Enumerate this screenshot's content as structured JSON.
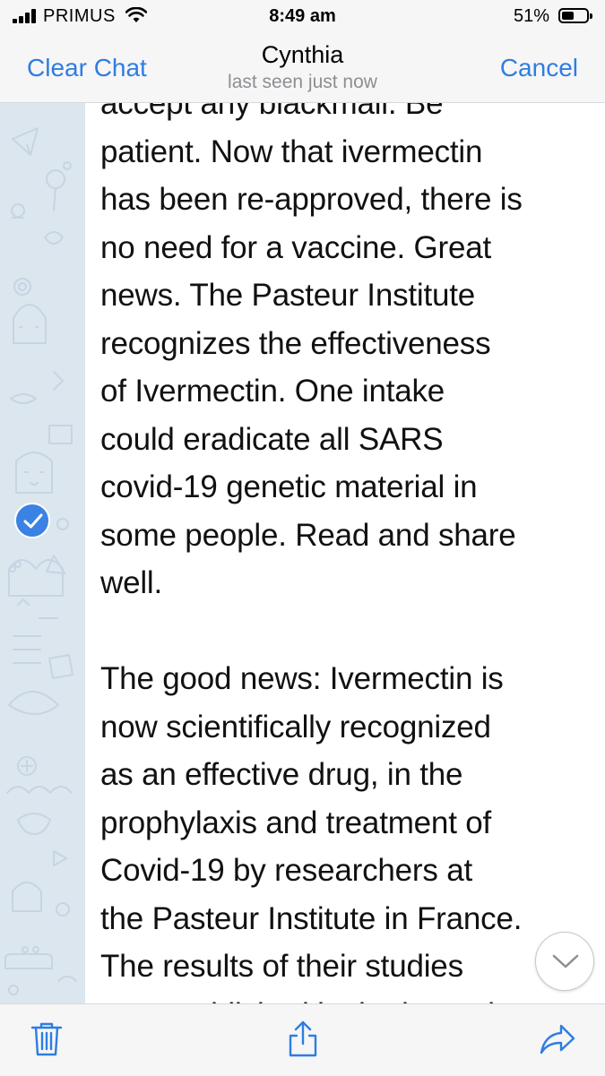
{
  "status_bar": {
    "carrier": "PRIMUS",
    "time": "8:49 am",
    "battery_percent": "51%",
    "battery_level": 0.51,
    "icons": [
      "signal-icon",
      "wifi-icon",
      "battery-icon"
    ]
  },
  "nav": {
    "left_button": "Clear Chat",
    "title": "Cynthia",
    "subtitle": "last seen just now",
    "right_button": "Cancel"
  },
  "message": {
    "selected": true,
    "paragraphs": [
      "accept any blackmail. Be\npatient. Now that ivermectin\nhas been re-approved, there is\nno need for a vaccine. Great\nnews. The Pasteur Institute\nrecognizes the effectiveness\nof Ivermectin. One intake\ncould eradicate all SARS\ncovid-19 genetic material in\nsome people. Read and share\nwell.",
      "The good news: Ivermectin is\nnow scientifically recognized\nas an effective drug, in the\nprophylaxis and treatment of\nCovid-19 by researchers at\nthe Pasteur Institute in France.\nThe results of their studies\nwere published in the journal"
    ]
  },
  "toolbar": {
    "icons": [
      "trash-icon",
      "share-icon",
      "forward-icon"
    ]
  },
  "colors": {
    "accent": "#2f7de1",
    "bar_background": "#f6f6f7",
    "pattern_background": "#dce6ef",
    "subtitle": "#8e8e93"
  }
}
